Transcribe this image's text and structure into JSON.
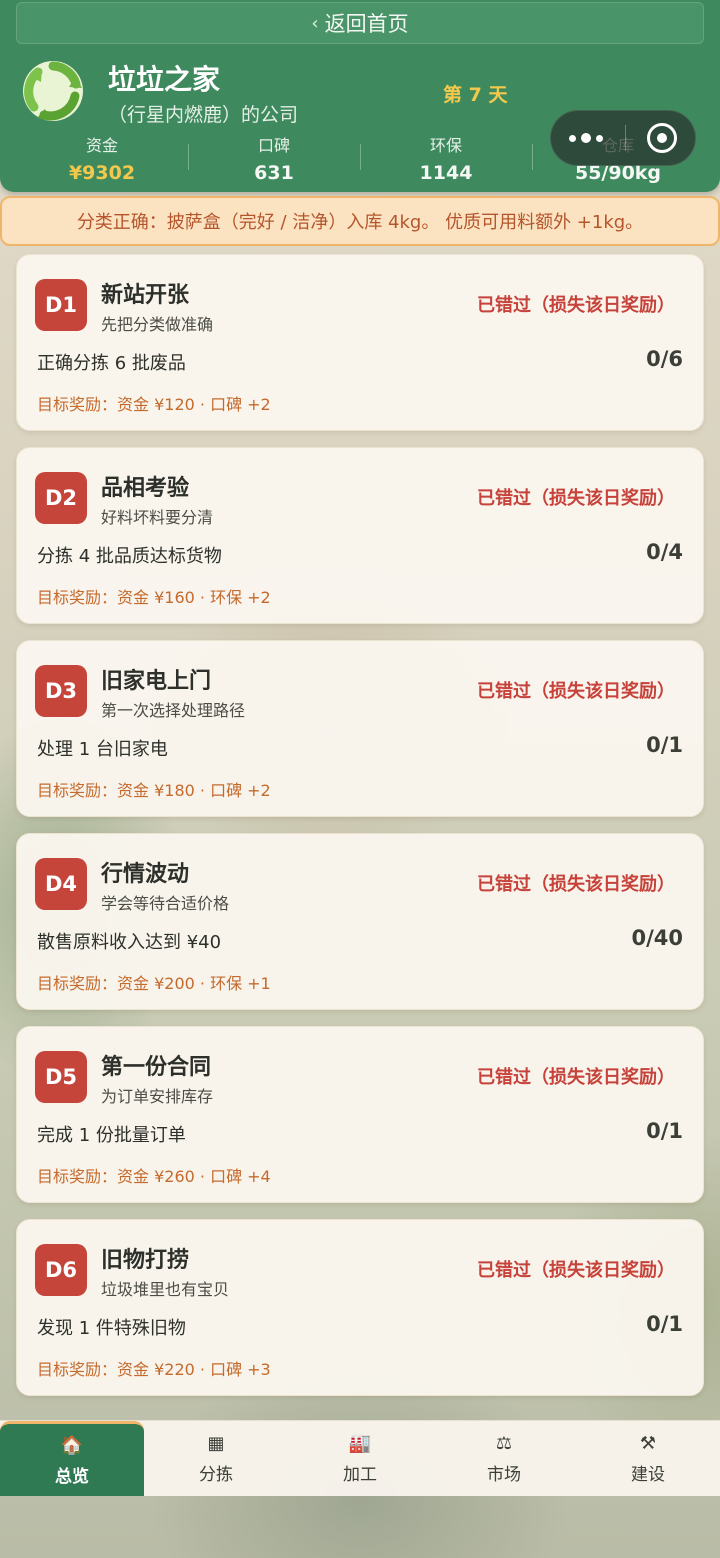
{
  "header": {
    "back_label": "返回首页",
    "company_name": "垃垃之家",
    "company_sub": "（行星内燃鹿）的公司",
    "day_label": "第 7 天",
    "stats": [
      {
        "label": "资金",
        "value": "¥9302"
      },
      {
        "label": "口碑",
        "value": "631"
      },
      {
        "label": "环保",
        "value": "1144"
      },
      {
        "label": "仓库",
        "value": "55/90kg"
      }
    ]
  },
  "notice": "分类正确：披萨盒（完好 / 洁净）入库 4kg。 优质可用料额外 +1kg。",
  "cards": [
    {
      "badge": "D1",
      "title": "新站开张",
      "sub": "先把分类做准确",
      "status": "已错过（损失该日奖励）",
      "task": "正确分拣 6 批废品",
      "progress": "0/6",
      "reward": "目标奖励：资金 ¥120 · 口碑 +2"
    },
    {
      "badge": "D2",
      "title": "品相考验",
      "sub": "好料坏料要分清",
      "status": "已错过（损失该日奖励）",
      "task": "分拣 4 批品质达标货物",
      "progress": "0/4",
      "reward": "目标奖励：资金 ¥160 · 环保 +2"
    },
    {
      "badge": "D3",
      "title": "旧家电上门",
      "sub": "第一次选择处理路径",
      "status": "已错过（损失该日奖励）",
      "task": "处理 1 台旧家电",
      "progress": "0/1",
      "reward": "目标奖励：资金 ¥180 · 口碑 +2"
    },
    {
      "badge": "D4",
      "title": "行情波动",
      "sub": "学会等待合适价格",
      "status": "已错过（损失该日奖励）",
      "task": "散售原料收入达到 ¥40",
      "progress": "0/40",
      "reward": "目标奖励：资金 ¥200 · 环保 +1"
    },
    {
      "badge": "D5",
      "title": "第一份合同",
      "sub": "为订单安排库存",
      "status": "已错过（损失该日奖励）",
      "task": "完成 1 份批量订单",
      "progress": "0/1",
      "reward": "目标奖励：资金 ¥260 · 口碑 +4"
    },
    {
      "badge": "D6",
      "title": "旧物打捞",
      "sub": "垃圾堆里也有宝贝",
      "status": "已错过（损失该日奖励）",
      "task": "发现 1 件特殊旧物",
      "progress": "0/1",
      "reward": "目标奖励：资金 ¥220 · 口碑 +3"
    }
  ],
  "nav": [
    {
      "label": "总览",
      "icon": "house-icon",
      "glyph": "🏠"
    },
    {
      "label": "分拣",
      "icon": "bins-icon",
      "glyph": "▦"
    },
    {
      "label": "加工",
      "icon": "factory-icon",
      "glyph": "🏭"
    },
    {
      "label": "市场",
      "icon": "scale-icon",
      "glyph": "⚖"
    },
    {
      "label": "建设",
      "icon": "tools-icon",
      "glyph": "⚒"
    }
  ],
  "colors": {
    "primary_green": "#3e8a5e",
    "accent_gold": "#f2c94c",
    "missed_red": "#c6423a",
    "badge_red": "#c5453b",
    "reward_orange": "#c56a2d"
  }
}
